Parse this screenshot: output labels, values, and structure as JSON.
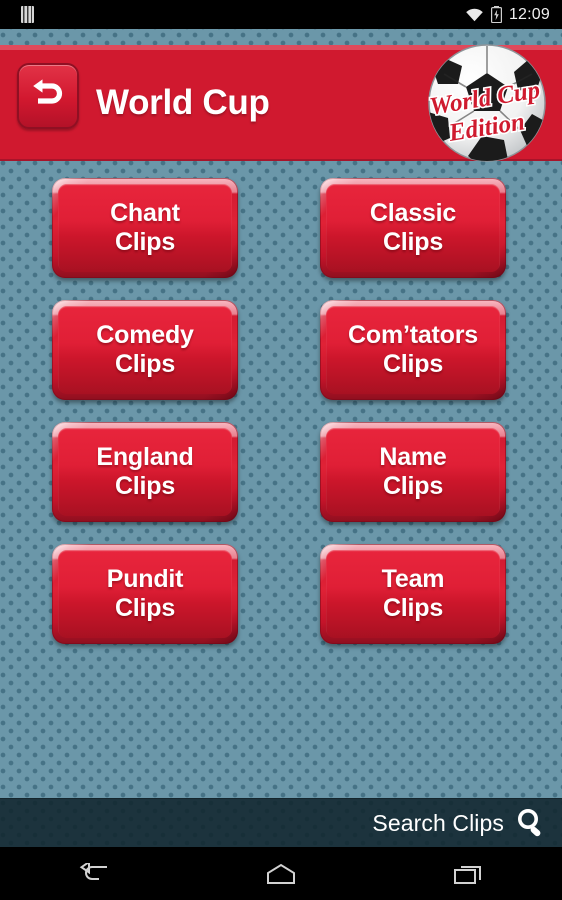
{
  "status_bar": {
    "sim_icon": "sim-card-icon",
    "wifi_icon": "wifi-icon",
    "battery_icon": "battery-charging-icon",
    "time": "12:09"
  },
  "header": {
    "back_button_icon": "back-arrow-icon",
    "title": "World Cup",
    "logo": {
      "icon": "soccer-ball-icon",
      "line1": "World Cup",
      "line2": "Edition"
    },
    "bg_color": "#d0192f"
  },
  "main": {
    "background_color": "#6b97a9",
    "buttons": [
      {
        "line1": "Chant",
        "line2": "Clips",
        "name": "chant-clips"
      },
      {
        "line1": "Classic",
        "line2": "Clips",
        "name": "classic-clips"
      },
      {
        "line1": "Comedy",
        "line2": "Clips",
        "name": "comedy-clips"
      },
      {
        "line1": "Com’tators",
        "line2": "Clips",
        "name": "comtators-clips"
      },
      {
        "line1": "England",
        "line2": "Clips",
        "name": "england-clips"
      },
      {
        "line1": "Name",
        "line2": "Clips",
        "name": "name-clips"
      },
      {
        "line1": "Pundit",
        "line2": "Clips",
        "name": "pundit-clips"
      },
      {
        "line1": "Team",
        "line2": "Clips",
        "name": "team-clips"
      }
    ]
  },
  "search": {
    "label": "Search Clips",
    "icon": "magnifier-icon"
  },
  "navigation": {
    "back_icon": "android-back-icon",
    "home_icon": "android-home-icon",
    "recents_icon": "android-recents-icon"
  }
}
